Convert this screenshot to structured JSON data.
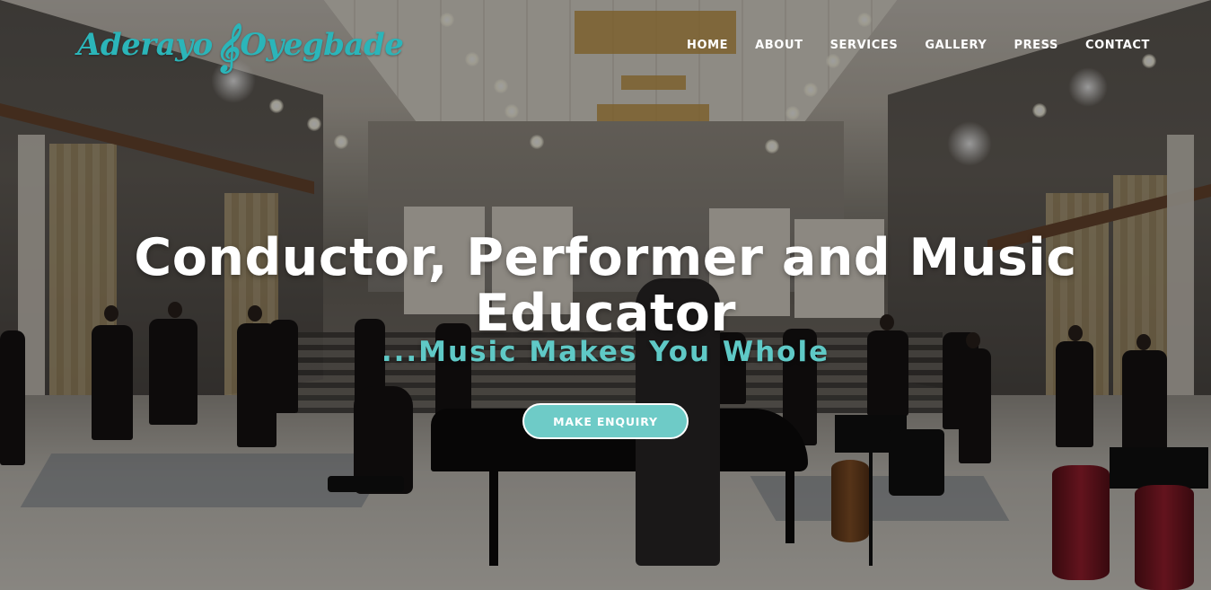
{
  "brand": {
    "logo_first": "Aderayo",
    "logo_last": "Oyegbade",
    "clef_glyph": "𝄞",
    "accent_color": "#2bb5b9"
  },
  "nav": {
    "items": [
      {
        "label": "HOME"
      },
      {
        "label": "ABOUT"
      },
      {
        "label": "SERVICES"
      },
      {
        "label": "GALLERY"
      },
      {
        "label": "PRESS"
      },
      {
        "label": "CONTACT"
      }
    ]
  },
  "hero": {
    "title_line1": "Conductor, Performer and Music",
    "title_line2": "Educator",
    "tagline": "...Music Makes You Whole",
    "tagline_color": "#5fc9c6",
    "cta_label": "MAKE ENQUIRY",
    "cta_color": "#6ecbc7",
    "background_image": "concert-hall-choir-photo"
  }
}
